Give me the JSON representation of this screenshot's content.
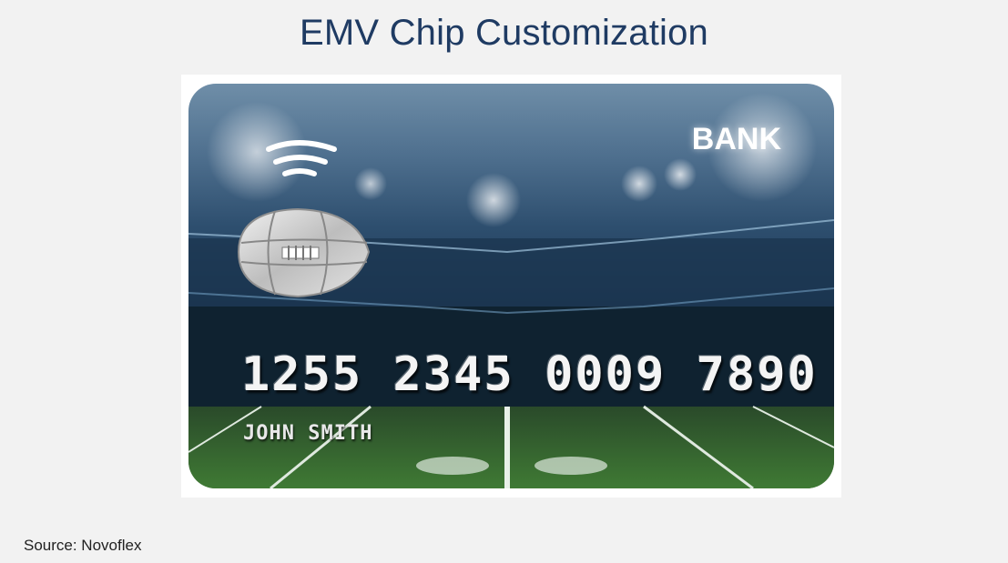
{
  "page": {
    "title": "EMV Chip Customization",
    "source": "Source: Novoflex"
  },
  "card": {
    "bank_label": "BANK",
    "number": "1255 2345 0009 7890",
    "holder_name": "JOHN SMITH",
    "chip_icon": "football-chip-icon",
    "contactless_icon": "contactless-icon",
    "background": "football stadium"
  }
}
